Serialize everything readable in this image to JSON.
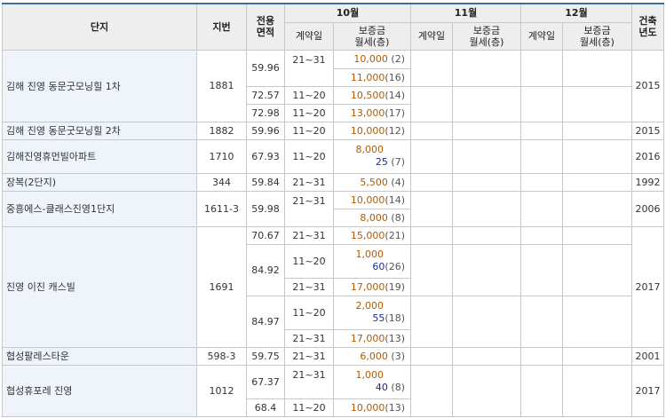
{
  "header": {
    "complex": "단지",
    "lot": "지번",
    "area": "전용\n면적",
    "months": [
      "10월",
      "11월",
      "12월"
    ],
    "contract_day": "계약일",
    "deposit_line1": "보증금",
    "deposit_line2": "월세(층)",
    "built": "건축\n년도"
  },
  "complexes": [
    {
      "name": "김해 진영 동문굿모닝힐 1차",
      "lot": "1881",
      "year": "2015",
      "rows": [
        {
          "area": "59.96",
          "day": "21~31",
          "deposit": "10,000",
          "rent": "",
          "floor": "(2)"
        },
        {
          "area": "59.96",
          "day": "21~31",
          "deposit": "11,000",
          "rent": "",
          "floor": "(16)"
        },
        {
          "area": "72.57",
          "day": "11~20",
          "deposit": "10,500",
          "rent": "",
          "floor": "(14)"
        },
        {
          "area": "72.98",
          "day": "11~20",
          "deposit": "13,000",
          "rent": "",
          "floor": "(17)"
        }
      ]
    },
    {
      "name": "김해 진영 동문굿모닝힐 2차",
      "lot": "1882",
      "year": "2015",
      "rows": [
        {
          "area": "59.96",
          "day": "11~20",
          "deposit": "10,000",
          "rent": "",
          "floor": "(12)"
        }
      ]
    },
    {
      "name": "김해진영휴먼빌아파트",
      "lot": "1710",
      "year": "2016",
      "rows": [
        {
          "area": "67.93",
          "day": "11~20",
          "deposit": "8,000",
          "rent": "25",
          "floor": "(7)"
        }
      ]
    },
    {
      "name": "장복(2단지)",
      "lot": "344",
      "year": "1992",
      "rows": [
        {
          "area": "59.84",
          "day": "21~31",
          "deposit": "5,500",
          "rent": "",
          "floor": "(4)"
        }
      ]
    },
    {
      "name": "중흥에스-클래스진영1단지",
      "lot": "1611-3",
      "year": "2006",
      "rows": [
        {
          "area": "59.98",
          "day": "21~31",
          "deposit": "10,000",
          "rent": "",
          "floor": "(14)"
        },
        {
          "area": "59.98",
          "day": "21~31",
          "deposit": "8,000",
          "rent": "",
          "floor": "(8)"
        }
      ]
    },
    {
      "name": "진영 이진 캐스빌",
      "lot": "1691",
      "year": "2017",
      "rows": [
        {
          "area": "70.67",
          "day": "21~31",
          "deposit": "15,000",
          "rent": "",
          "floor": "(21)"
        },
        {
          "area": "84.92",
          "day": "11~20",
          "deposit": "1,000",
          "rent": "60",
          "floor": "(26)"
        },
        {
          "area": "84.92",
          "day": "21~31",
          "deposit": "17,000",
          "rent": "",
          "floor": "(19)"
        },
        {
          "area": "84.97",
          "day": "11~20",
          "deposit": "2,000",
          "rent": "55",
          "floor": "(18)"
        },
        {
          "area": "84.97",
          "day": "21~31",
          "deposit": "17,000",
          "rent": "",
          "floor": "(13)"
        }
      ]
    },
    {
      "name": "협성팔레스타운",
      "lot": "598-3",
      "year": "2001",
      "rows": [
        {
          "area": "59.75",
          "day": "21~31",
          "deposit": "6,000",
          "rent": "",
          "floor": "(3)"
        }
      ]
    },
    {
      "name": "협성휴포레 진영",
      "lot": "1012",
      "year": "2017",
      "rows": [
        {
          "area": "67.37",
          "day": "21~31",
          "deposit": "1,000",
          "rent": "40",
          "floor": "(8)"
        },
        {
          "area": "68.4",
          "day": "11~20",
          "deposit": "10,000",
          "rent": "",
          "floor": "(13)"
        }
      ]
    }
  ]
}
